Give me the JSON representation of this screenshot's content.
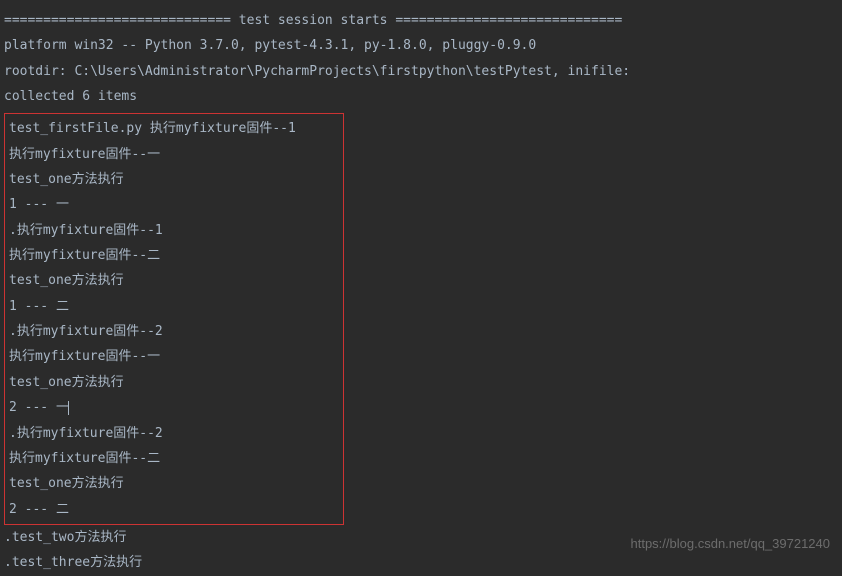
{
  "header": {
    "session_start": "============================= test session starts =============================",
    "platform": "platform win32 -- Python 3.7.0, pytest-4.3.1, py-1.8.0, pluggy-0.9.0",
    "rootdir": "rootdir: C:\\Users\\Administrator\\PycharmProjects\\firstpython\\testPytest, inifile:",
    "collected": "collected 6 items",
    "blank": ""
  },
  "boxed_lines": [
    "test_firstFile.py 执行myfixture固件--1",
    "执行myfixture固件--一",
    "test_one方法执行",
    "1 --- 一",
    ".执行myfixture固件--1",
    "执行myfixture固件--二",
    "test_one方法执行",
    "1 --- 二",
    ".执行myfixture固件--2",
    "执行myfixture固件--一",
    "test_one方法执行",
    "2 --- 一",
    ".执行myfixture固件--2",
    "执行myfixture固件--二",
    "test_one方法执行",
    "2 --- 二"
  ],
  "cursor_line_index": 11,
  "after_box": [
    ".test_two方法执行",
    ".test_three方法执行"
  ],
  "watermark": "https://blog.csdn.net/qq_39721240"
}
